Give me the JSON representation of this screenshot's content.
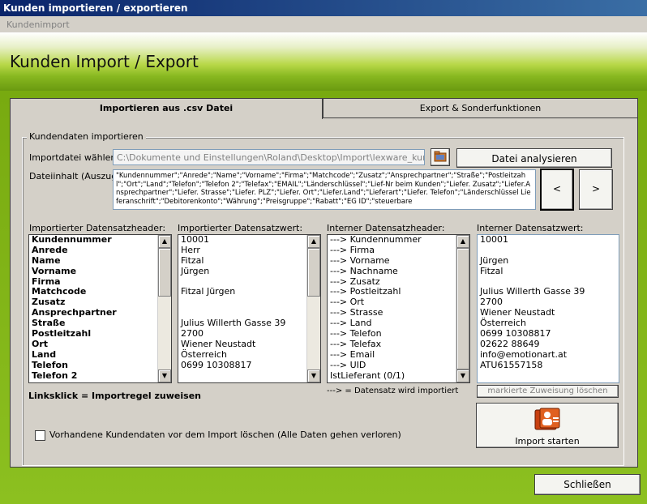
{
  "window": {
    "title": "Kunden importieren / exportieren"
  },
  "menu": {
    "item": "Kundenimport"
  },
  "header": {
    "title": "Kunden Import / Export"
  },
  "tabs": [
    {
      "label": "Importieren aus .csv Datei",
      "active": true
    },
    {
      "label": "Export & Sonderfunktionen",
      "active": false
    }
  ],
  "group": {
    "label": "Kundendaten importieren"
  },
  "import_file": {
    "label": "Importdatei wählen:",
    "value": "C:\\Dokumente und Einstellungen\\Roland\\Desktop\\Import\\lexware_kunden.txt",
    "browse_icon": "folder-icon",
    "analyze_label": "Datei analysieren"
  },
  "content_excerpt": {
    "label": "Dateiinhalt (Auszug):",
    "text": "\"Kundennummer\";\"Anrede\";\"Name\";\"Vorname\";\"Firma\";\"Matchcode\";\"Zusatz\";\"Ansprechpartner\";\"Straße\";\"Postleitzahl\";\"Ort\";\"Land\";\"Telefon\";\"Telefon 2\";\"Telefax\";\"EMAIL\";\"Länderschlüssel\";\"Lief-Nr beim Kunden\";\"Liefer. Zusatz\";\"Liefer.Ansprechpartner\";\"Liefer. Strasse\";\"Liefer. PLZ\";\"Liefer. Ort\";\"Liefer.Land\";\"Lieferart\";\"Liefer. Telefon\";\"Länderschlüssel Lieferanschrift\";\"Debitorenkonto\";\"Währung\";\"Preisgruppe\";\"Rabatt\";\"EG ID\";\"steuerbare",
    "prev_label": "<",
    "next_label": ">"
  },
  "columns": {
    "imported_header": {
      "label": "Importierter Datensatzheader:",
      "items": [
        "Kundennummer",
        "Anrede",
        "Name",
        "Vorname",
        "Firma",
        "Matchcode",
        "Zusatz",
        "Ansprechpartner",
        "Straße",
        "Postleitzahl",
        "Ort",
        "Land",
        "Telefon",
        "Telefon 2"
      ]
    },
    "imported_value": {
      "label": "Importierter Datensatzwert:",
      "items": [
        "10001",
        "Herr",
        "Fitzal",
        "Jürgen",
        "",
        "Fitzal Jürgen",
        "",
        "",
        "Julius Willerth Gasse 39",
        "2700",
        "Wiener Neustadt",
        "Österreich",
        "0699 10308817",
        ""
      ]
    },
    "internal_header": {
      "label": "Interner Datensatzheader:",
      "items": [
        "---> Kundennummer",
        "---> Firma",
        "---> Vorname",
        "---> Nachname",
        "---> Zusatz",
        "---> Postleitzahl",
        "---> Ort",
        "---> Strasse",
        "---> Land",
        "---> Telefon",
        "---> Telefax",
        "---> Email",
        "---> UID",
        "IstLieferant (0/1)"
      ]
    },
    "internal_value": {
      "label": "Interner Datensatzwert:",
      "items": [
        "10001",
        "",
        "Jürgen",
        "Fitzal",
        "",
        "Julius Willerth Gasse 39",
        "2700",
        "Wiener Neustadt",
        "Österreich",
        "0699 10308817",
        "02622 88649",
        "info@emotionart.at",
        "ATU61557158",
        ""
      ]
    }
  },
  "hint_left": "Linksklick = Importregel zuweisen",
  "hint_middle": "---> = Datensatz wird importiert",
  "clear_mapping_label": "markierte Zuweisung löschen",
  "start_import_label": "Import starten",
  "start_import_icon": "import-user-icon",
  "delete_existing": {
    "label": "Vorhandene Kundendaten vor dem Import löschen (Alle Daten gehen verloren)",
    "checked": false
  },
  "close_label": "Schließen"
}
